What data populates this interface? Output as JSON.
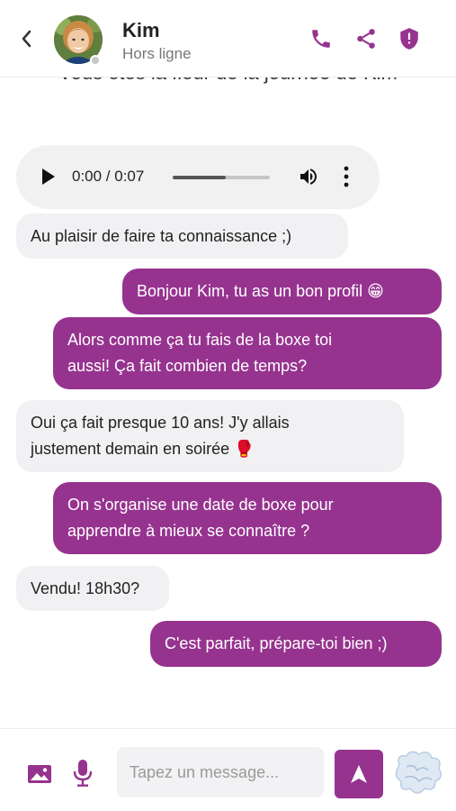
{
  "header": {
    "contact_name": "Kim",
    "contact_status": "Hors ligne"
  },
  "chat": {
    "system_text": "Vous êtes la fleur de la journée de Kim",
    "audio": {
      "time": "0:00 / 0:07",
      "progress": 0.55
    },
    "messages": [
      {
        "side": "in",
        "lines": [
          "Au plaisir de faire ta connaissance ;)"
        ]
      },
      {
        "side": "out",
        "lines": [
          "Bonjour Kim, tu as un bon profil 😁"
        ]
      },
      {
        "side": "out",
        "lines": [
          "Alors comme ça tu fais de la boxe toi",
          "aussi! Ça fait combien de temps?"
        ]
      },
      {
        "side": "in",
        "lines": [
          "Oui ça fait presque 10 ans! J'y allais",
          "justement demain en soirée 🥊"
        ]
      },
      {
        "side": "out",
        "lines": [
          "On s'organise une date de boxe pour",
          "apprendre à mieux se connaître ?"
        ]
      },
      {
        "side": "in",
        "lines": [
          "Vendu! 18h30?"
        ]
      },
      {
        "side": "out",
        "lines": [
          "C'est parfait, prépare-toi bien ;)"
        ]
      }
    ]
  },
  "footer": {
    "input_placeholder": "Tapez un message...",
    "input_value": ""
  },
  "colors": {
    "accent": "#96338f",
    "incoming_bubble": "#f1f1f3",
    "offline_dot": "#c7c7c7"
  },
  "icons": [
    "back-icon",
    "phone-icon",
    "share-icon",
    "shield-icon",
    "play-icon",
    "volume-icon",
    "more-vertical-icon",
    "image-icon",
    "microphone-icon",
    "send-icon",
    "sticker-icon"
  ]
}
